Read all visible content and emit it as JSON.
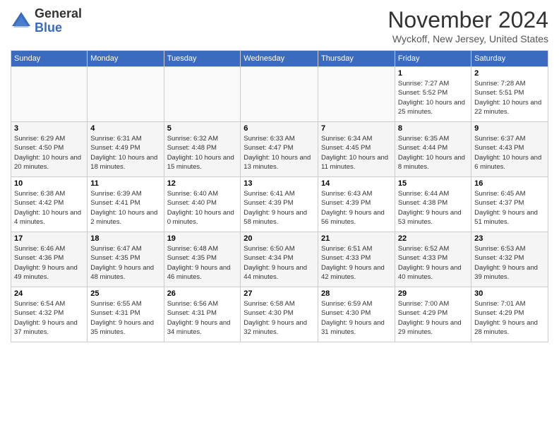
{
  "header": {
    "logo_general": "General",
    "logo_blue": "Blue",
    "month_title": "November 2024",
    "location": "Wyckoff, New Jersey, United States"
  },
  "days_of_week": [
    "Sunday",
    "Monday",
    "Tuesday",
    "Wednesday",
    "Thursday",
    "Friday",
    "Saturday"
  ],
  "weeks": [
    [
      {
        "day": "",
        "info": ""
      },
      {
        "day": "",
        "info": ""
      },
      {
        "day": "",
        "info": ""
      },
      {
        "day": "",
        "info": ""
      },
      {
        "day": "",
        "info": ""
      },
      {
        "day": "1",
        "info": "Sunrise: 7:27 AM\nSunset: 5:52 PM\nDaylight: 10 hours and 25 minutes."
      },
      {
        "day": "2",
        "info": "Sunrise: 7:28 AM\nSunset: 5:51 PM\nDaylight: 10 hours and 22 minutes."
      }
    ],
    [
      {
        "day": "3",
        "info": "Sunrise: 6:29 AM\nSunset: 4:50 PM\nDaylight: 10 hours and 20 minutes."
      },
      {
        "day": "4",
        "info": "Sunrise: 6:31 AM\nSunset: 4:49 PM\nDaylight: 10 hours and 18 minutes."
      },
      {
        "day": "5",
        "info": "Sunrise: 6:32 AM\nSunset: 4:48 PM\nDaylight: 10 hours and 15 minutes."
      },
      {
        "day": "6",
        "info": "Sunrise: 6:33 AM\nSunset: 4:47 PM\nDaylight: 10 hours and 13 minutes."
      },
      {
        "day": "7",
        "info": "Sunrise: 6:34 AM\nSunset: 4:45 PM\nDaylight: 10 hours and 11 minutes."
      },
      {
        "day": "8",
        "info": "Sunrise: 6:35 AM\nSunset: 4:44 PM\nDaylight: 10 hours and 8 minutes."
      },
      {
        "day": "9",
        "info": "Sunrise: 6:37 AM\nSunset: 4:43 PM\nDaylight: 10 hours and 6 minutes."
      }
    ],
    [
      {
        "day": "10",
        "info": "Sunrise: 6:38 AM\nSunset: 4:42 PM\nDaylight: 10 hours and 4 minutes."
      },
      {
        "day": "11",
        "info": "Sunrise: 6:39 AM\nSunset: 4:41 PM\nDaylight: 10 hours and 2 minutes."
      },
      {
        "day": "12",
        "info": "Sunrise: 6:40 AM\nSunset: 4:40 PM\nDaylight: 10 hours and 0 minutes."
      },
      {
        "day": "13",
        "info": "Sunrise: 6:41 AM\nSunset: 4:39 PM\nDaylight: 9 hours and 58 minutes."
      },
      {
        "day": "14",
        "info": "Sunrise: 6:43 AM\nSunset: 4:39 PM\nDaylight: 9 hours and 56 minutes."
      },
      {
        "day": "15",
        "info": "Sunrise: 6:44 AM\nSunset: 4:38 PM\nDaylight: 9 hours and 53 minutes."
      },
      {
        "day": "16",
        "info": "Sunrise: 6:45 AM\nSunset: 4:37 PM\nDaylight: 9 hours and 51 minutes."
      }
    ],
    [
      {
        "day": "17",
        "info": "Sunrise: 6:46 AM\nSunset: 4:36 PM\nDaylight: 9 hours and 49 minutes."
      },
      {
        "day": "18",
        "info": "Sunrise: 6:47 AM\nSunset: 4:35 PM\nDaylight: 9 hours and 48 minutes."
      },
      {
        "day": "19",
        "info": "Sunrise: 6:48 AM\nSunset: 4:35 PM\nDaylight: 9 hours and 46 minutes."
      },
      {
        "day": "20",
        "info": "Sunrise: 6:50 AM\nSunset: 4:34 PM\nDaylight: 9 hours and 44 minutes."
      },
      {
        "day": "21",
        "info": "Sunrise: 6:51 AM\nSunset: 4:33 PM\nDaylight: 9 hours and 42 minutes."
      },
      {
        "day": "22",
        "info": "Sunrise: 6:52 AM\nSunset: 4:33 PM\nDaylight: 9 hours and 40 minutes."
      },
      {
        "day": "23",
        "info": "Sunrise: 6:53 AM\nSunset: 4:32 PM\nDaylight: 9 hours and 39 minutes."
      }
    ],
    [
      {
        "day": "24",
        "info": "Sunrise: 6:54 AM\nSunset: 4:32 PM\nDaylight: 9 hours and 37 minutes."
      },
      {
        "day": "25",
        "info": "Sunrise: 6:55 AM\nSunset: 4:31 PM\nDaylight: 9 hours and 35 minutes."
      },
      {
        "day": "26",
        "info": "Sunrise: 6:56 AM\nSunset: 4:31 PM\nDaylight: 9 hours and 34 minutes."
      },
      {
        "day": "27",
        "info": "Sunrise: 6:58 AM\nSunset: 4:30 PM\nDaylight: 9 hours and 32 minutes."
      },
      {
        "day": "28",
        "info": "Sunrise: 6:59 AM\nSunset: 4:30 PM\nDaylight: 9 hours and 31 minutes."
      },
      {
        "day": "29",
        "info": "Sunrise: 7:00 AM\nSunset: 4:29 PM\nDaylight: 9 hours and 29 minutes."
      },
      {
        "day": "30",
        "info": "Sunrise: 7:01 AM\nSunset: 4:29 PM\nDaylight: 9 hours and 28 minutes."
      }
    ]
  ]
}
